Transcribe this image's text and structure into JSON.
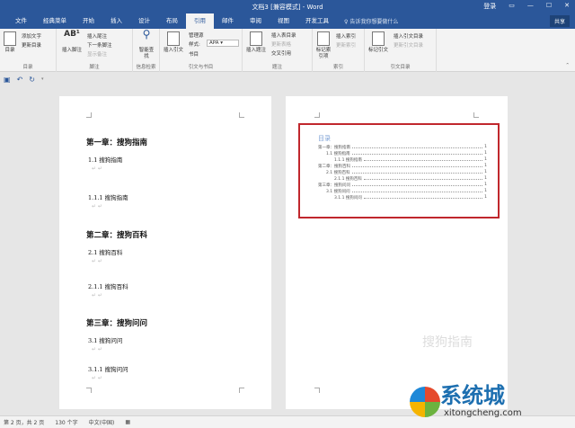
{
  "window": {
    "title": "文档3 [兼容模式] - Word",
    "login": "登录",
    "controls": [
      "▭",
      "—",
      "☐",
      "✕"
    ]
  },
  "tabs": [
    "文件",
    "经典菜单",
    "开始",
    "插入",
    "设计",
    "布局",
    "引用",
    "邮件",
    "审阅",
    "视图",
    "开发工具"
  ],
  "active_tab": "引用",
  "tell_me": "告诉我你想要做什么",
  "share": "共享",
  "ribbon": {
    "toc": {
      "big": "目录",
      "add_text": "添加文字",
      "update": "更新目录",
      "label": "目录"
    },
    "footnotes": {
      "big": "插入脚注",
      "insert_endnote": "插入尾注",
      "next": "下一条脚注",
      "show": "显示备注",
      "label": "脚注"
    },
    "research": {
      "big": "智能查找",
      "label": "信息检索"
    },
    "citations": {
      "big": "插入引文",
      "manage": "管理源",
      "style_label": "样式:",
      "style_value": "APA",
      "biblio": "书目",
      "label": "引文与书目"
    },
    "captions": {
      "big": "插入题注",
      "insert_table": "插入表目录",
      "update_table": "更新表格",
      "cross": "交叉引用",
      "label": "题注"
    },
    "index": {
      "big": "标记索引项",
      "insert": "插入索引",
      "update": "更新索引",
      "label": "索引"
    },
    "authorities": {
      "big": "标记引文",
      "insert": "插入引文目录",
      "update": "更新引文目录",
      "label": "引文目录"
    }
  },
  "left_page": {
    "items": [
      {
        "type": "h1",
        "text": "第一章：搜狗指南"
      },
      {
        "type": "h2",
        "text": "1.1 搜狗指南"
      },
      {
        "type": "h2",
        "text": "1.1.1 搜狗指南"
      },
      {
        "type": "h1",
        "text": "第二章：搜狗百科"
      },
      {
        "type": "h2",
        "text": "2.1 搜狗百科"
      },
      {
        "type": "h2",
        "text": "2.1.1 搜狗百科"
      },
      {
        "type": "h1",
        "text": "第三章：搜狗问问"
      },
      {
        "type": "h2",
        "text": "3.1 搜狗问问"
      },
      {
        "type": "h2",
        "text": "3.1.1 搜狗问问"
      }
    ]
  },
  "toc": {
    "heading": "目录",
    "entries": [
      {
        "text": "第一章：搜狗指南",
        "page": "1",
        "level": 1
      },
      {
        "text": "1.1 搜狗指南",
        "page": "1",
        "level": 2
      },
      {
        "text": "1.1.1 搜狗指南",
        "page": "1",
        "level": 3
      },
      {
        "text": "第二章：搜狗百科",
        "page": "1",
        "level": 1
      },
      {
        "text": "2.1 搜狗百科",
        "page": "1",
        "level": 2
      },
      {
        "text": "2.1.1 搜狗百科",
        "page": "1",
        "level": 3
      },
      {
        "text": "第三章：搜狗问问",
        "page": "1",
        "level": 1
      },
      {
        "text": "3.1 搜狗问问",
        "page": "1",
        "level": 2
      },
      {
        "text": "3.1.1 搜狗问问",
        "page": "1",
        "level": 3
      }
    ]
  },
  "status": {
    "page": "第 2 页，共 2 页",
    "words": "130 个字",
    "language": "中文(中国)"
  },
  "watermarks": {
    "sogou": "搜狗指南",
    "site": "系统城",
    "url": "xitongcheng.com"
  }
}
